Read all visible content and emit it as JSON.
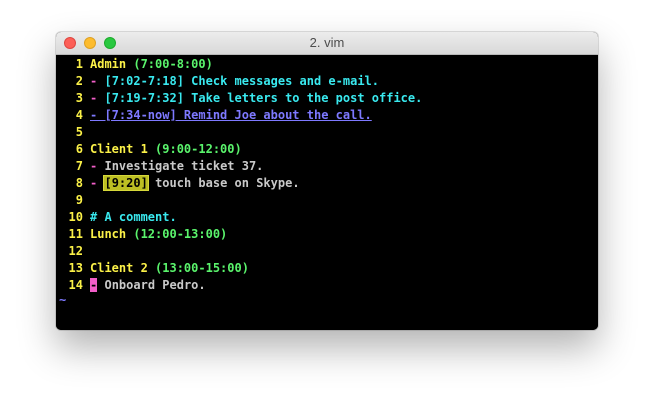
{
  "window": {
    "title": "2. vim"
  },
  "lines": [
    {
      "num": "1",
      "head": "Admin",
      "time": "(7:00-8:00)"
    },
    {
      "num": "2",
      "dash": "-",
      "body": "[7:02-7:18] Check messages and e-mail."
    },
    {
      "num": "3",
      "dash": "-",
      "body": "[7:19-7:32] Take letters to the post office."
    },
    {
      "num": "4",
      "body": "- [7:34-now] Remind Joe about the call."
    },
    {
      "num": "5"
    },
    {
      "num": "6",
      "head": "Client 1",
      "time": "(9:00-12:00)"
    },
    {
      "num": "7",
      "dash": "-",
      "body": "Investigate ticket 37."
    },
    {
      "num": "8",
      "dash": "-",
      "hl": "[9:20]",
      "body": "touch base on Skype."
    },
    {
      "num": "9"
    },
    {
      "num": "10",
      "body": "# A comment."
    },
    {
      "num": "11",
      "head": "Lunch",
      "time": "(12:00-13:00)"
    },
    {
      "num": "12"
    },
    {
      "num": "13",
      "head": "Client 2",
      "time": "(13:00-15:00)"
    },
    {
      "num": "14",
      "dash": "-",
      "body": "Onboard Pedro."
    }
  ],
  "tilde": "~",
  "colors": {
    "line_numbers": "#fbf148",
    "headings": "#fbf148",
    "times": "#5af46c",
    "done_items": "#39e9ef",
    "active_item": "#7e79ff",
    "dashes": "#f25ec9",
    "highlight_bg": "#bcbf23"
  }
}
